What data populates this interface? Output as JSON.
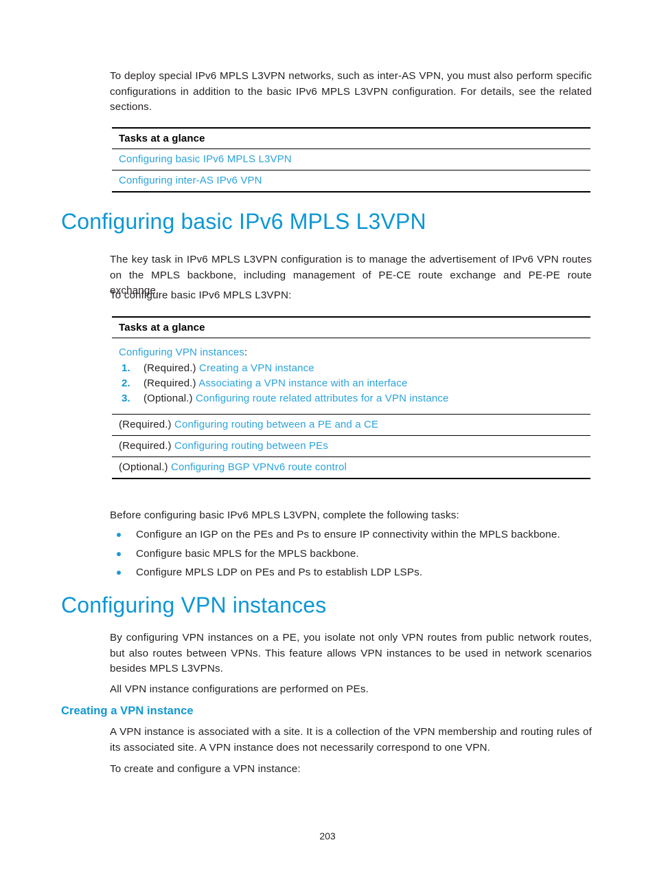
{
  "document": {
    "page_number": "203",
    "link_color": "#29a3dc",
    "heading_color": "#0d97d4",
    "bullet_color": "#1b9ad6"
  },
  "intro_paragraph": "To deploy special IPv6 MPLS L3VPN networks, such as inter-AS VPN, you must also perform specific configurations in addition to the basic IPv6 MPLS L3VPN configuration. For details, see the related sections.",
  "table_top": {
    "header": "Tasks at a glance",
    "rows": [
      {
        "link": "Configuring basic IPv6 MPLS L3VPN"
      },
      {
        "link": "Configuring inter-AS IPv6 VPN"
      }
    ]
  },
  "section_basic": {
    "heading": "Configuring basic IPv6 MPLS L3VPN",
    "paragraph_1": "The key task in IPv6 MPLS L3VPN configuration is to manage the advertisement of IPv6 VPN routes on the MPLS backbone, including management of PE-CE route exchange and PE-PE route exchange.",
    "paragraph_2": "To configure basic IPv6 MPLS L3VPN:"
  },
  "table_tasks": {
    "header": "Tasks at a glance",
    "group": {
      "intro_link": "Configuring VPN instances",
      "intro_suffix": ":",
      "steps": [
        {
          "num": "1.",
          "requirement": "(Required.)",
          "link": "Creating a VPN instance"
        },
        {
          "num": "2.",
          "requirement": "(Required.)",
          "link": "Associating a VPN instance with an interface"
        },
        {
          "num": "3.",
          "requirement": "(Optional.)",
          "link": "Configuring route related attributes for a VPN instance"
        }
      ]
    },
    "rows": [
      {
        "requirement": "(Required.)",
        "link": "Configuring routing between a PE and a CE"
      },
      {
        "requirement": "(Required.)",
        "link": "Configuring routing between PEs"
      },
      {
        "requirement": "(Optional.)",
        "link": "Configuring BGP VPNv6 route control"
      }
    ]
  },
  "prereq": {
    "lead_in": "Before configuring basic IPv6 MPLS L3VPN, complete the following tasks:",
    "items": [
      "Configure an IGP on the PEs and Ps to ensure IP connectivity within the MPLS backbone.",
      "Configure basic MPLS for the MPLS backbone.",
      "Configure MPLS LDP on PEs and Ps to establish LDP LSPs."
    ]
  },
  "section_vpn_instances": {
    "heading": "Configuring VPN instances",
    "paragraph_1": "By configuring VPN instances on a PE, you isolate not only VPN routes from public network routes, but also routes between VPNs. This feature allows VPN instances to be used in network scenarios besides MPLS L3VPNs.",
    "paragraph_2": "All VPN instance configurations are performed on PEs."
  },
  "section_creating": {
    "heading": "Creating a VPN instance",
    "paragraph_1": "A VPN instance is associated with a site. It is a collection of the VPN membership and routing rules of its associated site. A VPN instance does not necessarily correspond to one VPN.",
    "paragraph_2": "To create and configure a VPN instance:"
  }
}
